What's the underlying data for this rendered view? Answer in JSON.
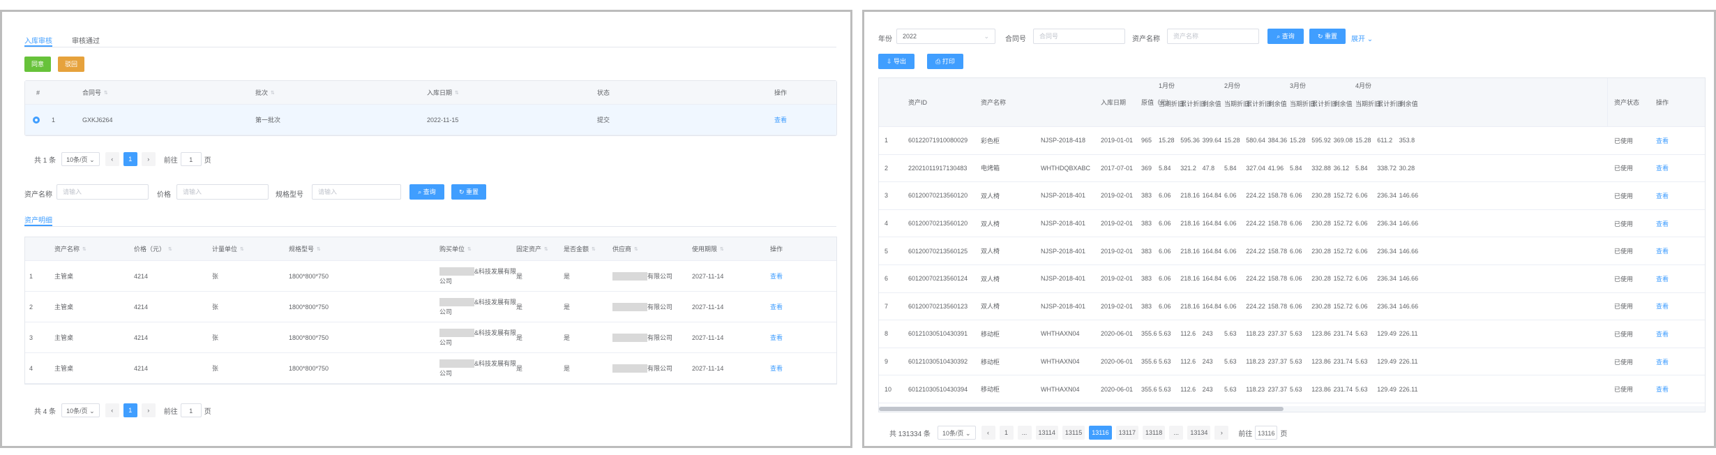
{
  "left": {
    "tabs": [
      "入库审核",
      "审核通过"
    ],
    "btn_approve": "同意",
    "btn_reject": "驳回",
    "top_table": {
      "headers": [
        "#",
        "合同号",
        "批次",
        "入库日期",
        "状态",
        "操作"
      ],
      "row": {
        "idx": "1",
        "contract": "GXKJ6264",
        "batch": "第一批次",
        "date": "2022-11-15",
        "status": "提交",
        "action": "查看"
      }
    },
    "pager1": {
      "total": "共 1 条",
      "size": "10条/页",
      "page": "1",
      "goto": "前往",
      "goto_val": "1",
      "unit": "页"
    },
    "filters": {
      "asset_label": "资产名称",
      "asset_ph": "请输入",
      "price_label": "价格",
      "price_ph": "请输入",
      "spec_label": "规格型号",
      "spec_ph": "请输入",
      "search": "查询",
      "reset": "重置"
    },
    "subtab": "资产明细",
    "detail_table": {
      "headers": [
        "资产名称",
        "价格（元）",
        "计量单位",
        "规格型号",
        "购买单位",
        "固定资产",
        "是否金额",
        "供应商",
        "使用期限",
        "操作"
      ],
      "rows": [
        {
          "idx": "1",
          "name": "主管桌",
          "price": "4214",
          "unit": "张",
          "spec": "1800*800*750",
          "buyer1": "&科技发展有限",
          "buyer2": "公司",
          "fixed": "是",
          "amt": "是",
          "supplier": "有限公司",
          "term": "2027-11-14",
          "action": "查看"
        },
        {
          "idx": "2",
          "name": "主管桌",
          "price": "4214",
          "unit": "张",
          "spec": "1800*800*750",
          "buyer1": "&科技发展有限",
          "buyer2": "公司",
          "fixed": "是",
          "amt": "是",
          "supplier": "有限公司",
          "term": "2027-11-14",
          "action": "查看"
        },
        {
          "idx": "3",
          "name": "主管桌",
          "price": "4214",
          "unit": "张",
          "spec": "1800*800*750",
          "buyer1": "&科技发展有限",
          "buyer2": "公司",
          "fixed": "是",
          "amt": "是",
          "supplier": "有限公司",
          "term": "2027-11-14",
          "action": "查看"
        },
        {
          "idx": "4",
          "name": "主管桌",
          "price": "4214",
          "unit": "张",
          "spec": "1800*800*750",
          "buyer1": "&科技发展有限",
          "buyer2": "公司",
          "fixed": "是",
          "amt": "是",
          "supplier": "有限公司",
          "term": "2027-11-14",
          "action": "查看"
        }
      ]
    },
    "pager2": {
      "total": "共 4 条",
      "size": "10条/页",
      "page": "1",
      "goto": "前往",
      "goto_val": "1",
      "unit": "页"
    }
  },
  "right": {
    "year_label": "年份",
    "year_val": "2022",
    "contract_label": "合同号",
    "contract_ph": "合同号",
    "asset_label": "资产名称",
    "asset_ph": "资产名称",
    "search": "查询",
    "reset": "重置",
    "expand": "展开",
    "export": "导出",
    "print": "打印",
    "months": [
      "1月份",
      "2月份",
      "3月份",
      "4月份"
    ],
    "headers": [
      "资产ID",
      "资产名称",
      "",
      "入库日期",
      "原值（元）"
    ],
    "sub_headers": [
      "当期折旧",
      "累计折旧",
      "剩余值"
    ],
    "tail_headers": [
      "资产状态",
      "操作"
    ],
    "rows": [
      {
        "idx": "1",
        "id": "60122071910080029",
        "name": "彩色柜",
        "code": "NJSP-2018-418",
        "date": "2019-01-01",
        "orig": "965",
        "m": [
          [
            "15.28",
            "595.36",
            "399.64"
          ],
          [
            "15.28",
            "580.64",
            "384.36"
          ],
          [
            "15.28",
            "595.92",
            "369.08"
          ],
          [
            "15.28",
            "611.2",
            "353.8"
          ]
        ],
        "status": "已使用",
        "action": "查看"
      },
      {
        "idx": "2",
        "id": "22021011917130483",
        "name": "电烤箱",
        "code": "WHTHDQBXABC",
        "date": "2017-07-01",
        "orig": "369",
        "m": [
          [
            "5.84",
            "321.2",
            "47.8"
          ],
          [
            "5.84",
            "327.04",
            "41.96"
          ],
          [
            "5.84",
            "332.88",
            "36.12"
          ],
          [
            "5.84",
            "338.72",
            "30.28"
          ]
        ],
        "status": "已使用",
        "action": "查看"
      },
      {
        "idx": "3",
        "id": "60120070213560120",
        "name": "双人椅",
        "code": "NJSP-2018-401",
        "date": "2019-02-01",
        "orig": "383",
        "m": [
          [
            "6.06",
            "218.16",
            "164.84"
          ],
          [
            "6.06",
            "224.22",
            "158.78"
          ],
          [
            "6.06",
            "230.28",
            "152.72"
          ],
          [
            "6.06",
            "236.34",
            "146.66"
          ]
        ],
        "status": "已使用",
        "action": "查看"
      },
      {
        "idx": "4",
        "id": "60120070213560120",
        "name": "双人椅",
        "code": "NJSP-2018-401",
        "date": "2019-02-01",
        "orig": "383",
        "m": [
          [
            "6.06",
            "218.16",
            "164.84"
          ],
          [
            "6.06",
            "224.22",
            "158.78"
          ],
          [
            "6.06",
            "230.28",
            "152.72"
          ],
          [
            "6.06",
            "236.34",
            "146.66"
          ]
        ],
        "status": "已使用",
        "action": "查看"
      },
      {
        "idx": "5",
        "id": "60120070213560125",
        "name": "双人椅",
        "code": "NJSP-2018-401",
        "date": "2019-02-01",
        "orig": "383",
        "m": [
          [
            "6.06",
            "218.16",
            "164.84"
          ],
          [
            "6.06",
            "224.22",
            "158.78"
          ],
          [
            "6.06",
            "230.28",
            "152.72"
          ],
          [
            "6.06",
            "236.34",
            "146.66"
          ]
        ],
        "status": "已使用",
        "action": "查看"
      },
      {
        "idx": "6",
        "id": "60120070213560124",
        "name": "双人椅",
        "code": "NJSP-2018-401",
        "date": "2019-02-01",
        "orig": "383",
        "m": [
          [
            "6.06",
            "218.16",
            "164.84"
          ],
          [
            "6.06",
            "224.22",
            "158.78"
          ],
          [
            "6.06",
            "230.28",
            "152.72"
          ],
          [
            "6.06",
            "236.34",
            "146.66"
          ]
        ],
        "status": "已使用",
        "action": "查看"
      },
      {
        "idx": "7",
        "id": "60120070213560123",
        "name": "双人椅",
        "code": "NJSP-2018-401",
        "date": "2019-02-01",
        "orig": "383",
        "m": [
          [
            "6.06",
            "218.16",
            "164.84"
          ],
          [
            "6.06",
            "224.22",
            "158.78"
          ],
          [
            "6.06",
            "230.28",
            "152.72"
          ],
          [
            "6.06",
            "236.34",
            "146.66"
          ]
        ],
        "status": "已使用",
        "action": "查看"
      },
      {
        "idx": "8",
        "id": "60121030510430391",
        "name": "移动柜",
        "code": "WHTHAXN04",
        "date": "2020-06-01",
        "orig": "355.6",
        "m": [
          [
            "5.63",
            "112.6",
            "243"
          ],
          [
            "5.63",
            "118.23",
            "237.37"
          ],
          [
            "5.63",
            "123.86",
            "231.74"
          ],
          [
            "5.63",
            "129.49",
            "226.11"
          ]
        ],
        "status": "已使用",
        "action": "查看"
      },
      {
        "idx": "9",
        "id": "60121030510430392",
        "name": "移动柜",
        "code": "WHTHAXN04",
        "date": "2020-06-01",
        "orig": "355.6",
        "m": [
          [
            "5.63",
            "112.6",
            "243"
          ],
          [
            "5.63",
            "118.23",
            "237.37"
          ],
          [
            "5.63",
            "123.86",
            "231.74"
          ],
          [
            "5.63",
            "129.49",
            "226.11"
          ]
        ],
        "status": "已使用",
        "action": "查看"
      },
      {
        "idx": "10",
        "id": "60121030510430394",
        "name": "移动柜",
        "code": "WHTHAXN04",
        "date": "2020-06-01",
        "orig": "355.6",
        "m": [
          [
            "5.63",
            "112.6",
            "243"
          ],
          [
            "5.63",
            "118.23",
            "237.37"
          ],
          [
            "5.63",
            "123.86",
            "231.74"
          ],
          [
            "5.63",
            "129.49",
            "226.11"
          ]
        ],
        "status": "已使用",
        "action": "查看"
      }
    ],
    "pager": {
      "total": "共 131334 条",
      "size": "10条/页",
      "pages": [
        "1",
        "...",
        "13114",
        "13115",
        "13116",
        "13117",
        "13118",
        "...",
        "13134"
      ],
      "active": "13116",
      "goto": "前往",
      "goto_val": "13116",
      "unit": "页"
    }
  }
}
